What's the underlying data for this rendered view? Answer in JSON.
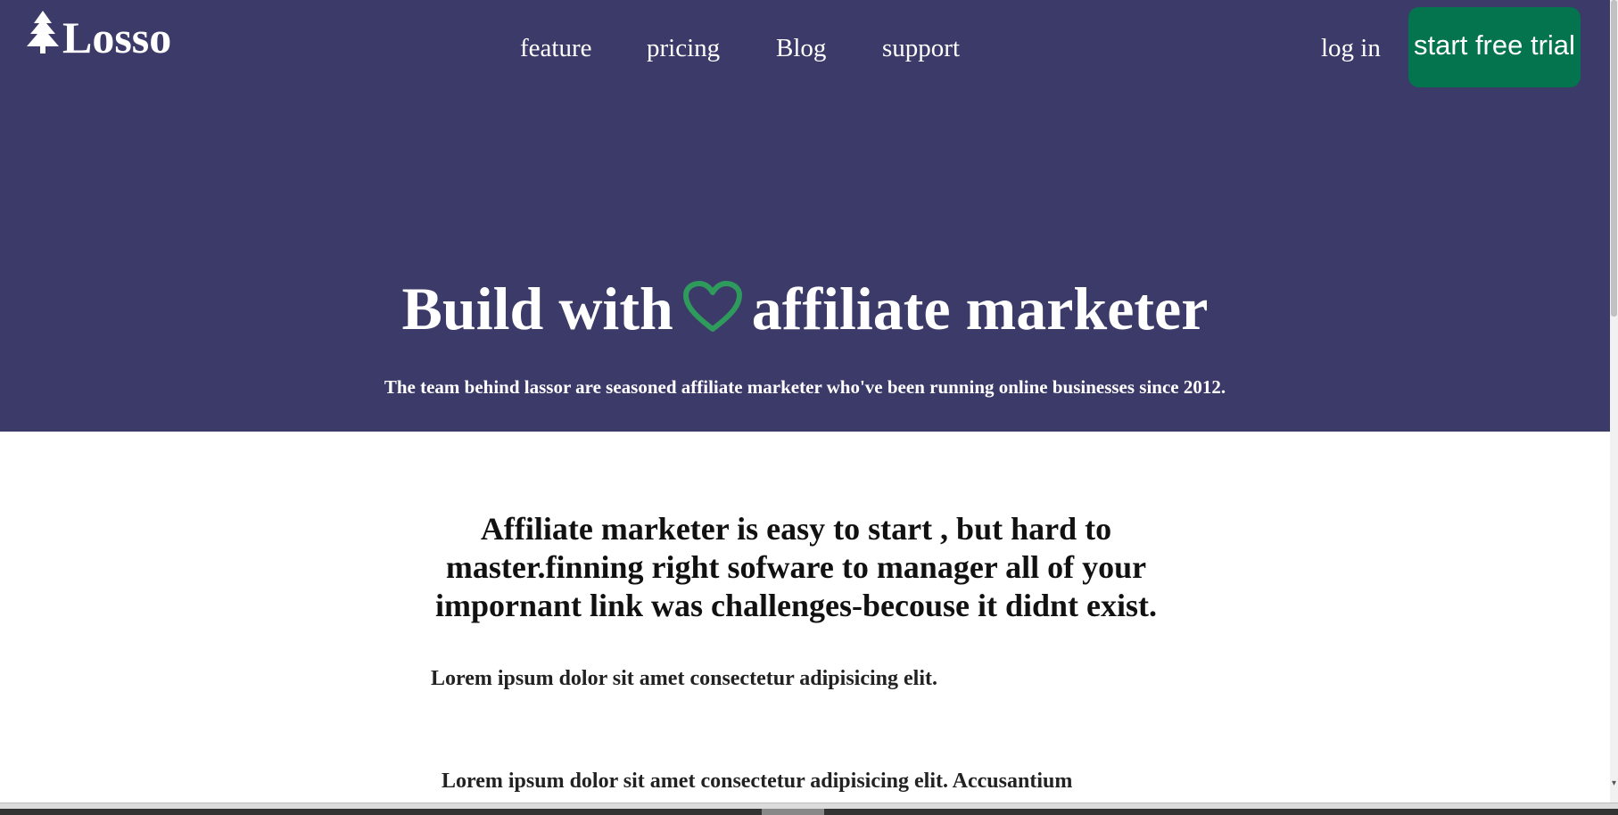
{
  "header": {
    "brand": "Losso",
    "nav": [
      "feature",
      "pricing",
      "Blog",
      "support"
    ],
    "login": "log in",
    "cta": "start free trial"
  },
  "hero": {
    "headline_left": "Build with",
    "headline_right": "affiliate marketer",
    "subhead": "The team behind lassor are seasoned affiliate marketer who've been running online businesses since 2012."
  },
  "content": {
    "title": "Affiliate marketer is easy to start , but hard to master.finning right sofware to manager all of your impornant link was challenges-becouse it didnt exist.",
    "para1": "Lorem ipsum dolor sit amet consectetur adipisicing elit.",
    "para2": "Lorem ipsum dolor sit amet consectetur adipisicing elit. Accusantium"
  },
  "colors": {
    "hero_bg": "#3c3a69",
    "cta_bg": "#03744d",
    "heart": "#2e9b5c"
  },
  "icons": {
    "logo": "tree-icon",
    "headline": "heart-icon"
  }
}
